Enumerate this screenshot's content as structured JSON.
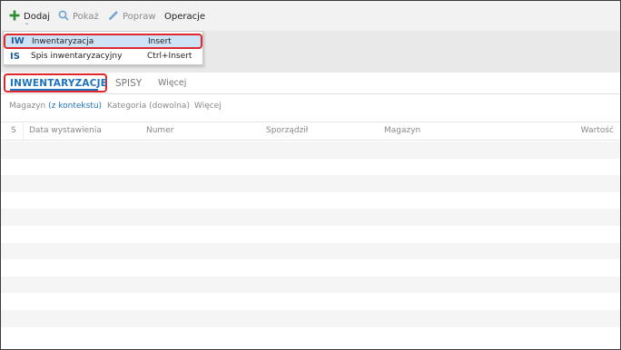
{
  "toolbar": {
    "dodaj": "Dodaj",
    "pokaz": "Pokaż",
    "popraw": "Popraw",
    "operacje": "Operacje"
  },
  "dropdown": {
    "items": [
      {
        "code": "IW",
        "name": "Inwentaryzacja",
        "shortcut": "Insert"
      },
      {
        "code": "IS",
        "name": "Spis inwentaryzacyjny",
        "shortcut": "Ctrl+Insert"
      }
    ]
  },
  "tabs": {
    "inwentaryzacje": "INWENTARYZACJE",
    "spisy": "SPISY",
    "wiecej": "Więcej"
  },
  "filters": {
    "magazyn_label": "Magazyn ",
    "magazyn_value": "(z kontekstu)",
    "kategoria": "Kategoria (dowolna)",
    "wiecej": "Więcej"
  },
  "grid": {
    "columns": [
      "S",
      "Data wystawienia",
      "Numer",
      "Sporządził",
      "Magazyn",
      "Wartość"
    ]
  },
  "colors": {
    "accent": "#1e73be",
    "highlight": "#e0272d",
    "selection": "#cfe3f7",
    "add_icon": "#2e8b2e"
  }
}
